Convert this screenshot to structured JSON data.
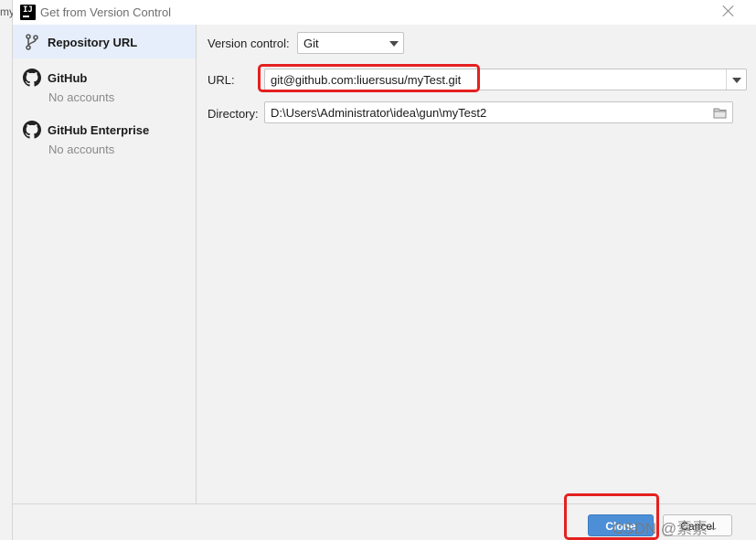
{
  "background_window": {
    "title_fragment": "my"
  },
  "dialog": {
    "title": "Get from Version Control"
  },
  "sidebar": {
    "items": [
      {
        "label": "Repository URL",
        "sublabel": "",
        "icon": "branch-icon",
        "selected": true
      },
      {
        "label": "GitHub",
        "sublabel": "No accounts",
        "icon": "github-icon",
        "selected": false
      },
      {
        "label": "GitHub Enterprise",
        "sublabel": "No accounts",
        "icon": "github-icon",
        "selected": false
      }
    ]
  },
  "form": {
    "version_control": {
      "label": "Version control:",
      "value": "Git"
    },
    "url": {
      "label": "URL:",
      "value": "git@github.com:liuersusu/myTest.git"
    },
    "directory": {
      "label": "Directory:",
      "value": "D:\\Users\\Administrator\\idea\\gun\\myTest2"
    }
  },
  "buttons": {
    "clone": "Clone",
    "cancel": "Cancel"
  },
  "watermark": "CSDN @素素~",
  "colors": {
    "accent": "#4d8fd6",
    "selection": "#e6eefb",
    "annotation": "#e52020"
  }
}
